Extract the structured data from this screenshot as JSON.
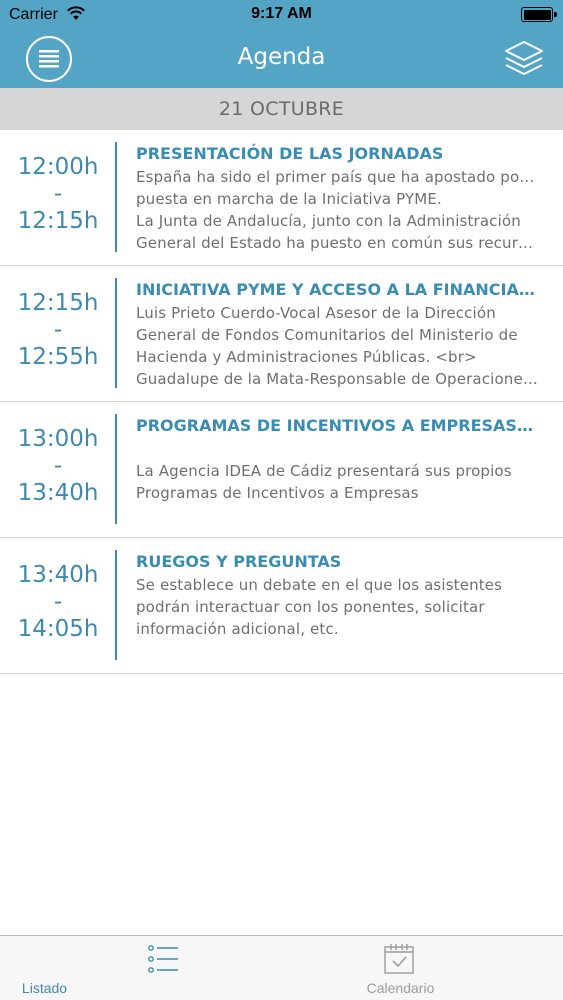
{
  "status_bar": {
    "carrier": "Carrier",
    "time": "9:17 AM"
  },
  "nav_bar": {
    "title": "Agenda",
    "left_icon": "menu-list-icon",
    "right_icon": "layers-icon"
  },
  "section_header": "21 OCTUBRE",
  "events": [
    {
      "start": "12:00h",
      "separator": "-",
      "end": "12:15h",
      "title": "PRESENTACIÓN DE LAS JORNADAS",
      "desc_lines": [
        "España ha sido el primer país que ha apostado por la",
        "puesta en marcha de la Iniciativa PYME.",
        "La Junta de Andalucía, junto con la Administración",
        "General del Estado ha puesto en común sus recurs…"
      ]
    },
    {
      "start": "12:15h",
      "separator": "-",
      "end": "12:55h",
      "title": "INICIATIVA PYME Y ACCESO A LA FINANCIAC…",
      "desc_lines": [
        "Luis Prieto Cuerdo-Vocal Asesor de la Dirección",
        "General de Fondos Comunitarios del Ministerio de",
        "Hacienda y Administraciones Públicas. <br>",
        "Guadalupe de la Mata-Responsable de Operacione…"
      ]
    },
    {
      "start": "13:00h",
      "separator": "-",
      "end": "13:40h",
      "title": "PROGRAMAS DE INCENTIVOS A EMPRESAS…",
      "desc_lines": [
        "",
        "La Agencia IDEA de Cádiz presentará sus propios",
        "Programas de Incentivos a Empresas"
      ]
    },
    {
      "start": "13:40h",
      "separator": "-",
      "end": "14:05h",
      "title": "RUEGOS Y PREGUNTAS",
      "desc_lines": [
        "Se establece un debate en el que los asistentes",
        "podrán interactuar con los ponentes, solicitar",
        "información adicional, etc."
      ]
    }
  ],
  "tab_bar": {
    "tabs": [
      {
        "label": "Listado",
        "icon": "list-icon",
        "active": true
      },
      {
        "label": "Calendario",
        "icon": "calendar-icon",
        "active": false
      }
    ]
  },
  "colors": {
    "brand": "#54a4c6",
    "accent": "#3f8aab",
    "header_bg": "#d6d6d6",
    "inactive": "#9b9b9b"
  }
}
